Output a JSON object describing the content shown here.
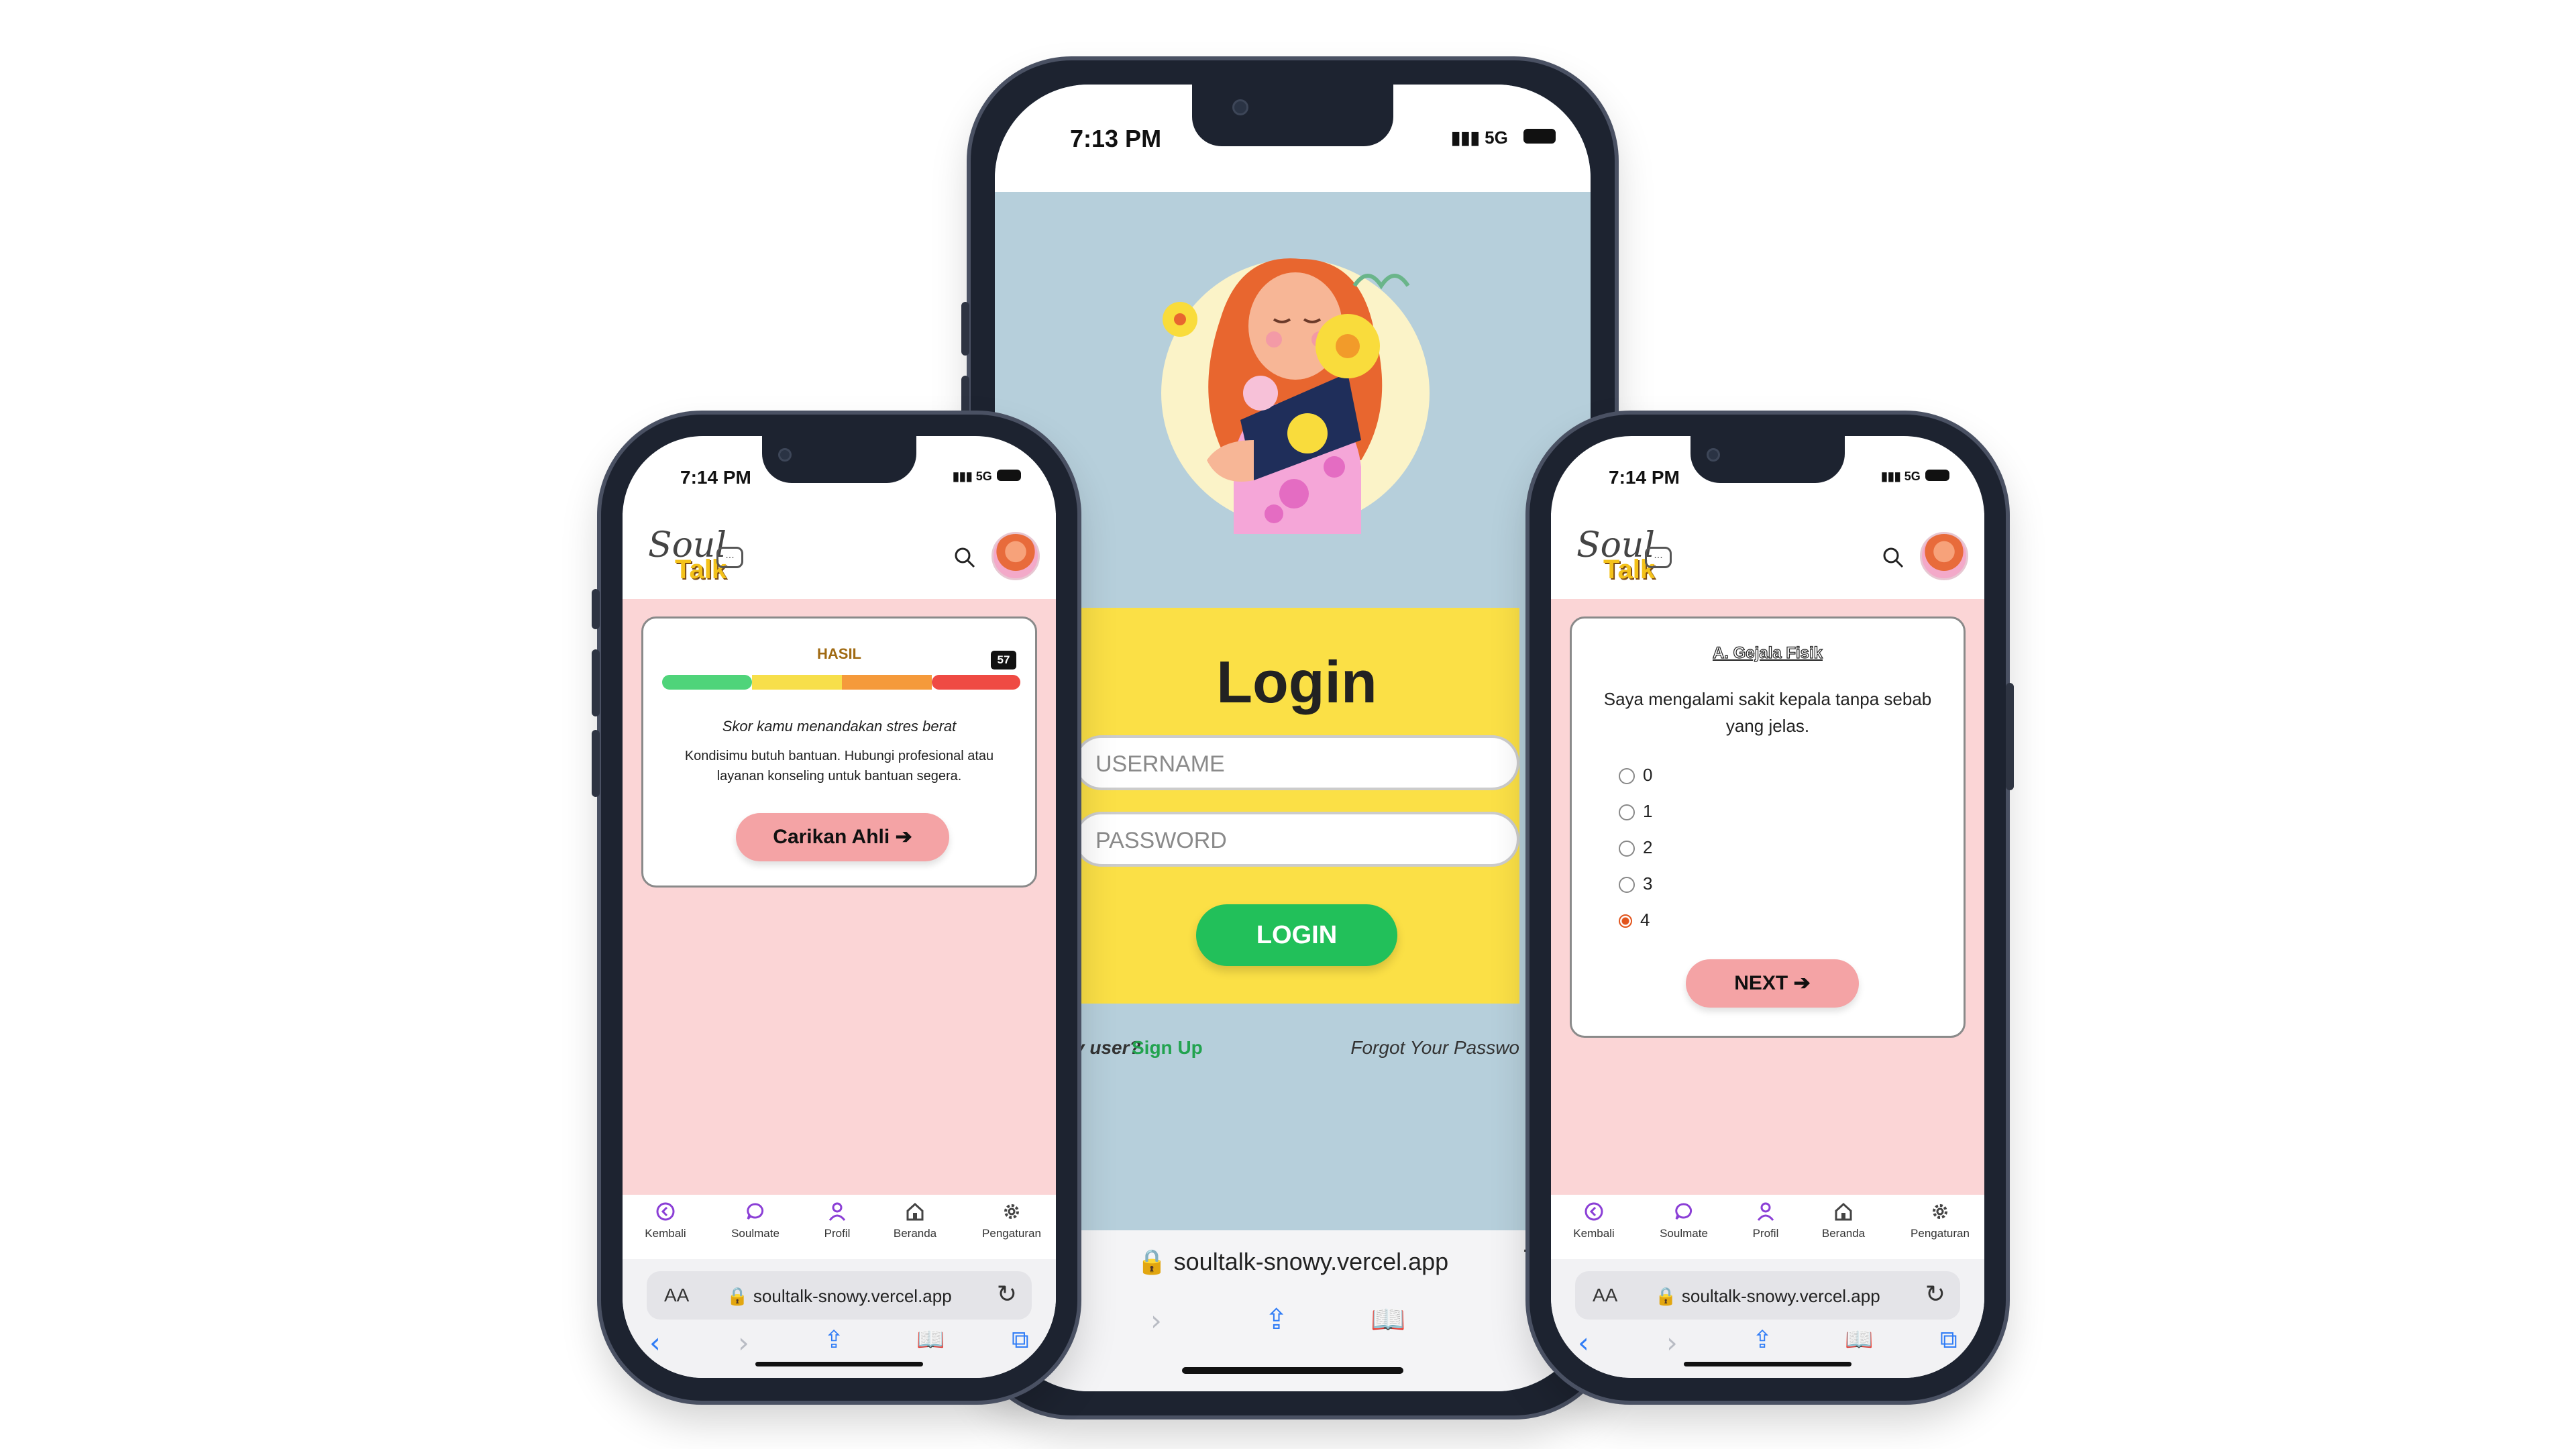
{
  "left_phone": {
    "status": {
      "time": "7:14 PM",
      "signal": "5G"
    },
    "logo": {
      "soul": "Soul",
      "talk": "Talk",
      "bubble": "..."
    },
    "result": {
      "label": "HASIL",
      "score": "57",
      "score_fraction": 0.95,
      "segments": [
        "#4fd47a",
        "#f7df4a",
        "#f59a3b",
        "#ef4a43"
      ],
      "headline": "Skor kamu menandakan stres berat",
      "body": "Kondisimu butuh bantuan. Hubungi profesional atau layanan konseling untuk bantuan segera.",
      "button": "Carikan Ahli",
      "button_arrow": "➔"
    },
    "nav": [
      {
        "label": "Kembali",
        "icon": "back-circle-icon"
      },
      {
        "label": "Soulmate",
        "icon": "chat-bubble-icon"
      },
      {
        "label": "Profil",
        "icon": "person-icon"
      },
      {
        "label": "Beranda",
        "icon": "home-icon"
      },
      {
        "label": "Pengaturan",
        "icon": "gear-icon"
      }
    ],
    "safari": {
      "aa": "AA",
      "url": "🔒 soultalk-snowy.vercel.app"
    }
  },
  "center_phone": {
    "status": {
      "time": "7:13 PM",
      "signal": "5G"
    },
    "login": {
      "title": "Login",
      "username_placeholder": "USERNAME",
      "password_placeholder": "PASSWORD",
      "button": "LOGIN"
    },
    "links": {
      "new_user": "v user?",
      "sign_up": "Sign Up",
      "forgot": "Forgot Your Passwo"
    },
    "safari": {
      "aa": "A",
      "url": "🔒 soultalk-snowy.vercel.app"
    }
  },
  "right_phone": {
    "status": {
      "time": "7:14 PM",
      "signal": "5G"
    },
    "logo": {
      "soul": "Soul",
      "talk": "Talk",
      "bubble": "..."
    },
    "quiz": {
      "section": "A. Gejala Fisik",
      "question": "Saya mengalami sakit kepala tanpa sebab yang jelas.",
      "options": [
        "0",
        "1",
        "2",
        "3",
        "4"
      ],
      "selected": "4",
      "button": "NEXT",
      "button_arrow": "➔"
    },
    "nav": [
      {
        "label": "Kembali",
        "icon": "back-circle-icon"
      },
      {
        "label": "Soulmate",
        "icon": "chat-bubble-icon"
      },
      {
        "label": "Profil",
        "icon": "person-icon"
      },
      {
        "label": "Beranda",
        "icon": "home-icon"
      },
      {
        "label": "Pengaturan",
        "icon": "gear-icon"
      }
    ],
    "safari": {
      "aa": "AA",
      "url": "🔒 soultalk-snowy.vercel.app"
    }
  },
  "colors": {
    "accent_purple": "#8b3fd6",
    "pink_bg": "#fbd5d6",
    "pink_button": "#f4a3a5",
    "login_yellow": "#fbe046",
    "login_green": "#22c05a",
    "login_bg": "#b6cfdb",
    "safari_blue": "#2f7cf6"
  }
}
